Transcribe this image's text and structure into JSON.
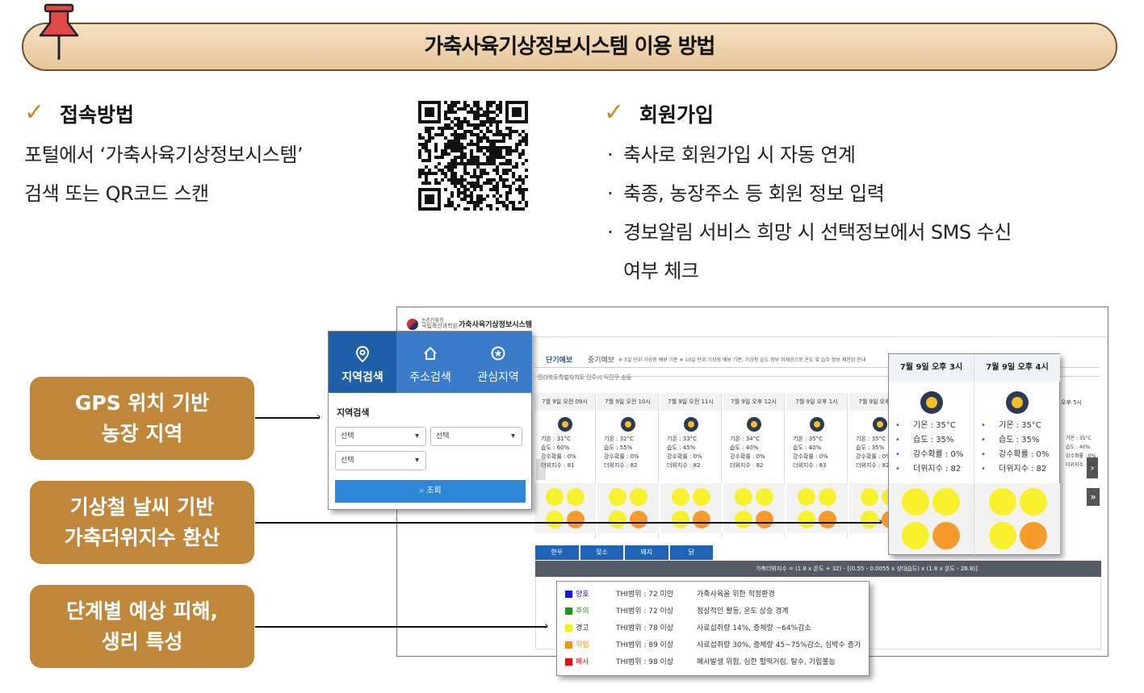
{
  "title": "가축사육기상정보시스템 이용 방법",
  "access": {
    "heading": "접속방법",
    "line1": "포털에서 ‘가축사육기상정보시스템’",
    "line2": "검색 또는 QR코드 스캔"
  },
  "signup": {
    "heading": "회원가입",
    "items": [
      "축사로 회원가입 시 자동 연계",
      "축종, 농장주소 등 회원 정보 입력",
      "경보알림 서비스 희망 시 선택정보에서 SMS 수신",
      "여부 체크"
    ]
  },
  "labels": [
    {
      "line1": "GPS 위치 기반",
      "line2": "농장 지역"
    },
    {
      "line1": "기상철 날씨 기반",
      "line2": "가축더위지수 환산"
    },
    {
      "line1": "단계별 예상 피해,",
      "line2": "생리 특성"
    }
  ],
  "screenshot": {
    "agency_small": "농촌진흥청",
    "agency": "국립축산과학원",
    "system": "가축사육기상정보시스템",
    "tabs": [
      "단기예보",
      "중기예보"
    ],
    "notice": "※ 3일 단위 기상청 예보 기준 ※ 10일 단위 기상청 예보 기준, 가상청 습도 정보 미제공으로 온도 및 습수 정보 제한된 안내",
    "region": "전라북도특별자치도 전주시 덕진구 송동",
    "times": [
      "7월 9일 오전 09시",
      "7월 9일 오전 10시",
      "7월 9일 오전 11시",
      "7월 9일 오후 12시",
      "7월 9일 오후 1시",
      "7월 9일 오후 2시"
    ],
    "temps": [
      "기온 : 31°C",
      "기온 : 32°C",
      "기온 : 33°C",
      "기온 : 34°C",
      "기온 : 35°C",
      "기온 : 35°C"
    ],
    "humid": [
      "습도 : 60%",
      "습도 : 55%",
      "습도 : 45%",
      "습도 : 40%",
      "습도 : 40%",
      "습도 : 35%"
    ],
    "rain": [
      "강수확률 : 0%",
      "강수확률 : 0%",
      "강수확률 : 0%",
      "강수확률 : 0%",
      "강수확률 : 0%",
      "강수확률 : 0%"
    ],
    "thi": [
      "더위지수 : 81",
      "더위지수 : 82",
      "더위지수 : 82",
      "더위지수 : 82",
      "더위지수 : 83",
      "더위지수 : 82"
    ],
    "last_time": "오후 5시",
    "last_stats": [
      "기온 : 35°C",
      "습도 : 40%",
      "강수확률 : 0%",
      "더위지수 : 82"
    ],
    "animal_tabs": [
      "한우",
      "젖소",
      "돼지",
      "닭"
    ],
    "formula": "가축더위지수 = (1.8 x 온도 + 32) - [(0.55 - 0.0055 x 상대습도) x (1.8 x 온도 - 26.8)]"
  },
  "search_popup": {
    "tabs": [
      "지역검색",
      "주소검색",
      "관심지역"
    ],
    "section": "지역검색",
    "sel1": "선택",
    "sel2": "선택",
    "sel3": "선택",
    "button": "조회"
  },
  "zoom": {
    "times": [
      "7월 9일 오후 3시",
      "7월 9일 오후 4시"
    ],
    "col1": [
      "기온 : 35°C",
      "습도 : 35%",
      "강수확률 : 0%",
      "더위지수 : 82"
    ],
    "col2": [
      "기온 : 35°C",
      "습도 : 35%",
      "강수확률 : 0%",
      "더위지수 : 82"
    ]
  },
  "legend": [
    {
      "level": "양호",
      "color": "#1a1ad6",
      "range": "THI범위 : 72 미만",
      "desc": "가축사육을 위한 적정환경"
    },
    {
      "level": "주의",
      "color": "#1a9a1a",
      "range": "THI범위 : 72 이상",
      "desc": "정상적인 활동, 온도 상승 경계"
    },
    {
      "level": "경고",
      "color": "#f2ee20",
      "range": "THI범위 : 78 이상",
      "desc": "사료섭취량 14%, 증체량 ~64%감소"
    },
    {
      "level": "위험",
      "color": "#f39200",
      "range": "THI범위 : 89 이상",
      "desc": "사료섭취량 30%, 증체량 45~75%감소, 심박수 증가"
    },
    {
      "level": "폐사",
      "color": "#e01010",
      "range": "THI범위 : 98 이상",
      "desc": "폐사발생 위험, 심한 헐떡거림, 탈수, 기립불능"
    }
  ]
}
